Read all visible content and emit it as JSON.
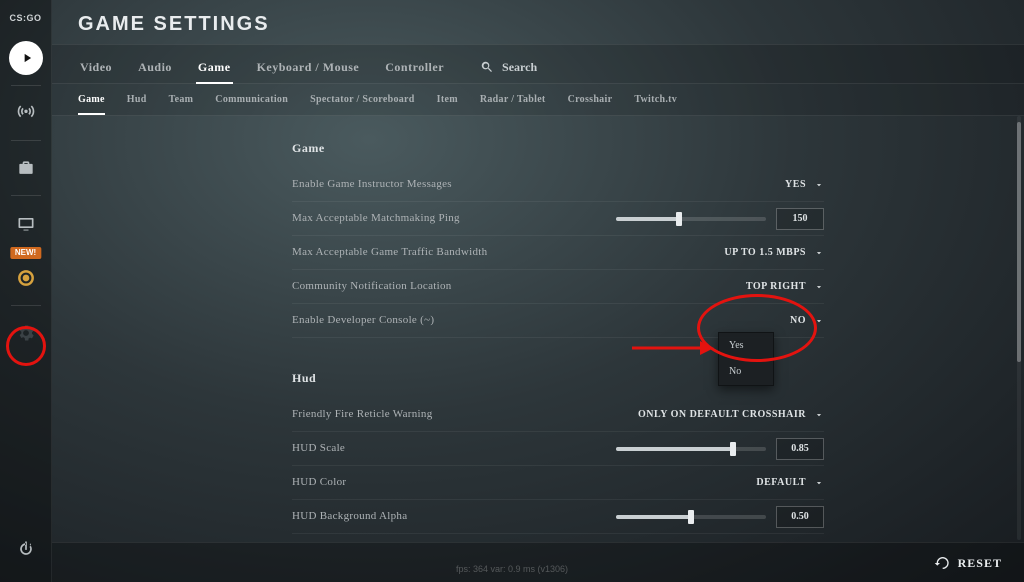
{
  "brand": "CS:GO",
  "page_title": "GAME SETTINGS",
  "rail": {
    "new_badge": "NEW!"
  },
  "tabs_primary": [
    "Video",
    "Audio",
    "Game",
    "Keyboard / Mouse",
    "Controller"
  ],
  "tabs_primary_active": 2,
  "search_label": "Search",
  "tabs_secondary": [
    "Game",
    "Hud",
    "Team",
    "Communication",
    "Spectator / Scoreboard",
    "Item",
    "Radar / Tablet",
    "Crosshair",
    "Twitch.tv"
  ],
  "tabs_secondary_active": 0,
  "sections": {
    "game": {
      "title": "Game",
      "rows": {
        "instructor": {
          "label": "Enable Game Instructor Messages",
          "value": "YES"
        },
        "ping": {
          "label": "Max Acceptable Matchmaking Ping",
          "value": "150",
          "slider": 0.42
        },
        "bandwidth": {
          "label": "Max Acceptable Game Traffic Bandwidth",
          "value": "UP TO 1.5 MBPS"
        },
        "notify": {
          "label": "Community Notification Location",
          "value": "TOP RIGHT"
        },
        "devcon": {
          "label": "Enable Developer Console (~)",
          "value": "NO",
          "options": [
            "Yes",
            "No"
          ]
        }
      }
    },
    "hud": {
      "title": "Hud",
      "rows": {
        "ffwarn": {
          "label": "Friendly Fire Reticle Warning",
          "value": "ONLY ON DEFAULT CROSSHAIR"
        },
        "scale": {
          "label": "HUD Scale",
          "value": "0.85",
          "slider": 0.78
        },
        "color": {
          "label": "HUD Color",
          "value": "DEFAULT"
        },
        "bgalpha": {
          "label": "HUD Background Alpha",
          "value": "0.50",
          "slider": 0.5
        }
      }
    }
  },
  "reset_label": "RESET",
  "fps_text": "fps: 364 var: 0.9 ms (v1306)"
}
